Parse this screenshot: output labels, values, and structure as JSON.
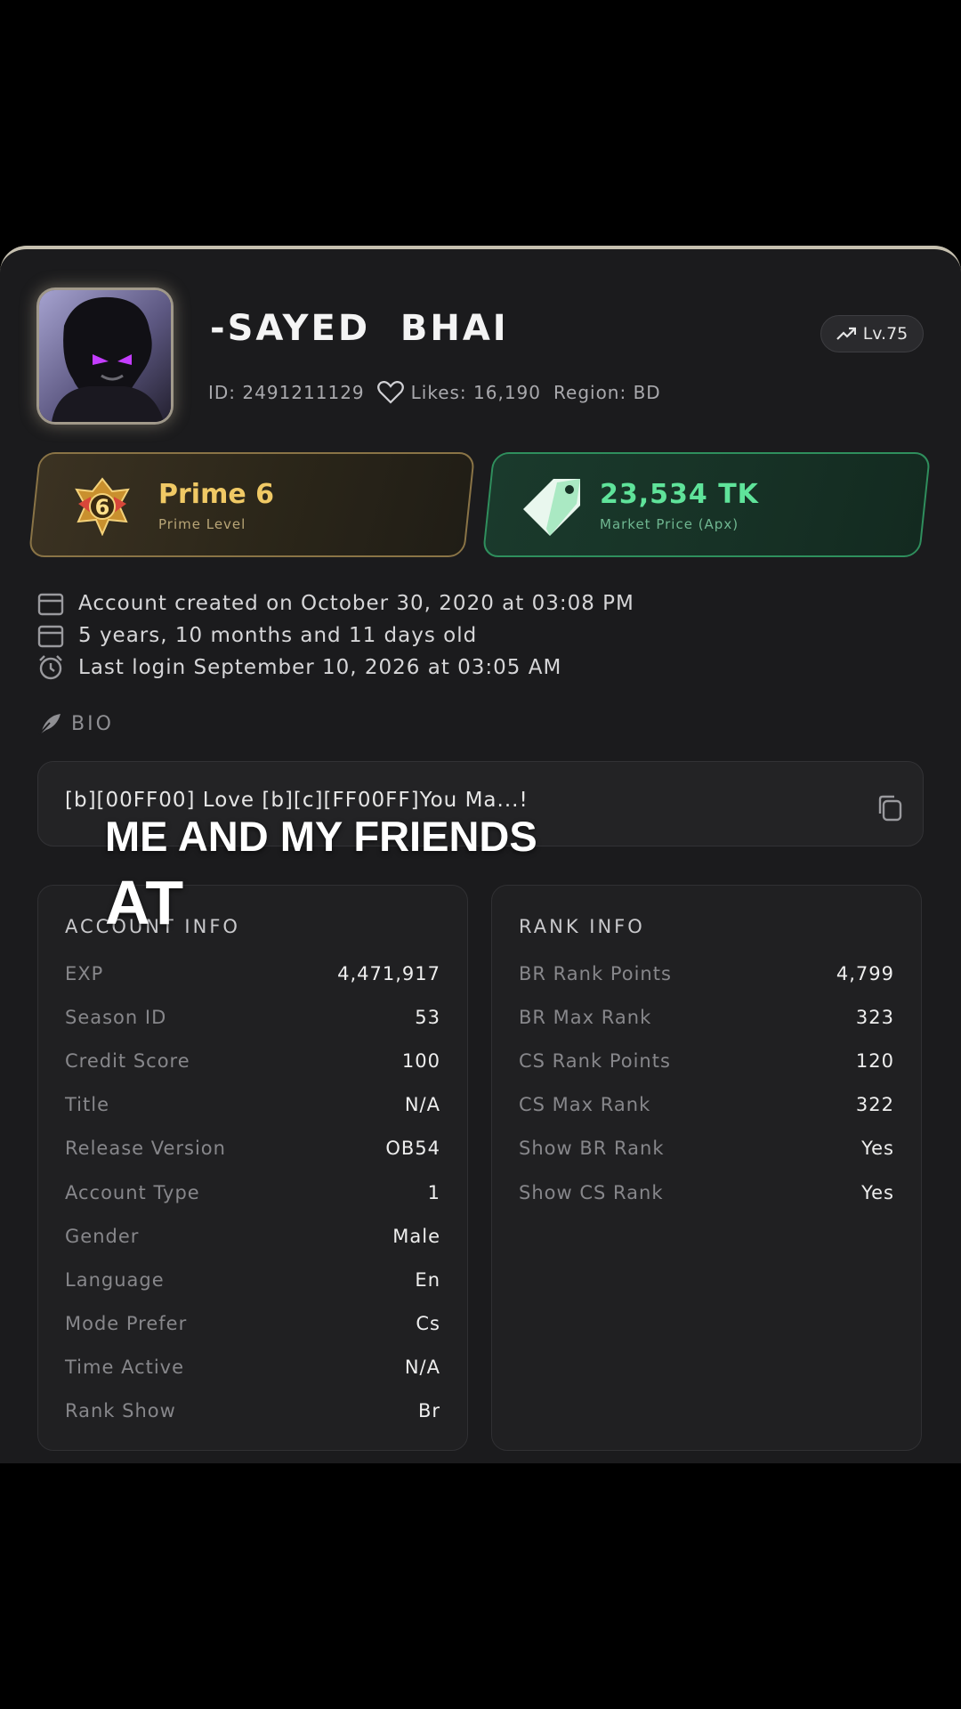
{
  "profile": {
    "name": "-SAYED  BHAI",
    "id_text": "ID: 2491211129",
    "likes_text": "Likes: 16,190",
    "region_text": "Region: BD",
    "level": "Lv.75"
  },
  "badges": {
    "prime": {
      "value": "Prime 6",
      "label": "Prime Level",
      "emblem_number": "6"
    },
    "market": {
      "value": "23,534 TK",
      "label": "Market Price (Apx)"
    }
  },
  "account_lines": [
    {
      "icon": "calendar-icon",
      "text": "Account created on October 30, 2020 at 03:08 PM"
    },
    {
      "icon": "calendar-icon",
      "text": "5 years, 10 months and 11 days old"
    },
    {
      "icon": "alarm-clock-icon",
      "text": "Last login September 10, 2026 at 03:05 AM"
    }
  ],
  "bio": {
    "heading": "BIO",
    "text": "[b][00FF00] Love  [b][c][FF00FF]You  Ma...!"
  },
  "account_info": {
    "title": "ACCOUNT INFO",
    "rows": [
      {
        "key": "EXP",
        "value": "4,471,917"
      },
      {
        "key": "Season ID",
        "value": "53"
      },
      {
        "key": "Credit Score",
        "value": "100"
      },
      {
        "key": "Title",
        "value": "N/A"
      },
      {
        "key": "Release Version",
        "value": "OB54"
      },
      {
        "key": "Account Type",
        "value": "1"
      },
      {
        "key": "Gender",
        "value": "Male"
      },
      {
        "key": "Language",
        "value": "En"
      },
      {
        "key": "Mode Prefer",
        "value": "Cs"
      },
      {
        "key": "Time Active",
        "value": "N/A"
      },
      {
        "key": "Rank Show",
        "value": "Br"
      }
    ]
  },
  "rank_info": {
    "title": "RANK INFO",
    "rows": [
      {
        "key": "BR Rank Points",
        "value": "4,799"
      },
      {
        "key": "BR Max Rank",
        "value": "323"
      },
      {
        "key": "CS Rank Points",
        "value": "120"
      },
      {
        "key": "CS Max Rank",
        "value": "322"
      },
      {
        "key": "Show BR Rank",
        "value": "Yes"
      },
      {
        "key": "Show CS Rank",
        "value": "Yes"
      }
    ]
  },
  "caption": {
    "line1": "ME AND MY FRIENDS",
    "line2": "AT"
  },
  "colors": {
    "background": "#000000",
    "card": "#1b1b1d",
    "prime_gold": "#f0c965",
    "market_green": "#5fe39a"
  }
}
